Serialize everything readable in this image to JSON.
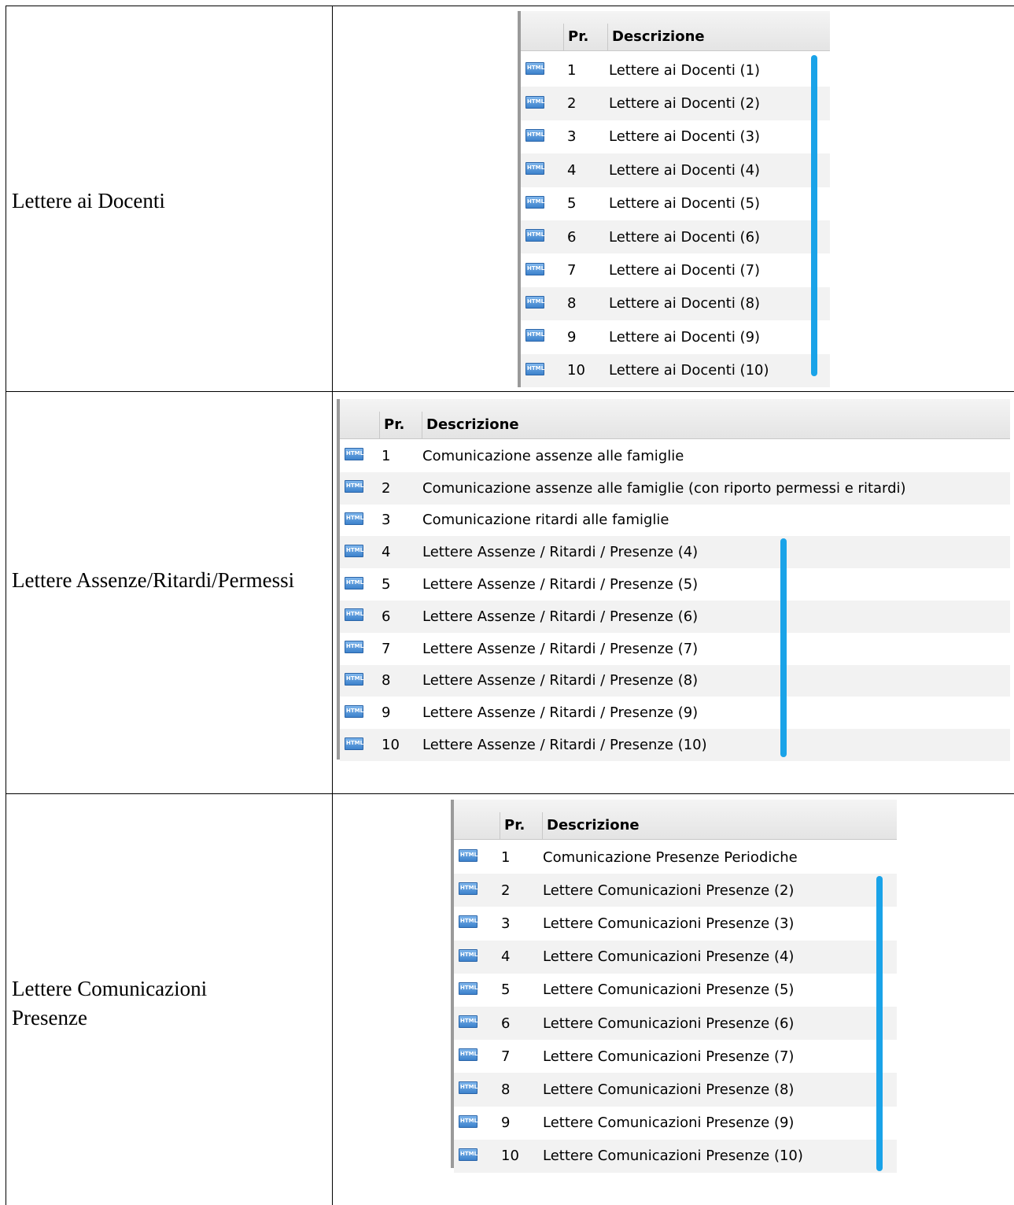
{
  "sections": [
    {
      "label": "Lettere ai Docenti",
      "grid": {
        "header": {
          "pr": "Pr.",
          "desc": "Descrizione"
        },
        "rows": [
          {
            "pr": "1",
            "desc": "Lettere ai Docenti (1)"
          },
          {
            "pr": "2",
            "desc": "Lettere ai Docenti (2)"
          },
          {
            "pr": "3",
            "desc": "Lettere ai Docenti (3)"
          },
          {
            "pr": "4",
            "desc": "Lettere ai Docenti (4)"
          },
          {
            "pr": "5",
            "desc": "Lettere ai Docenti (5)"
          },
          {
            "pr": "6",
            "desc": "Lettere ai Docenti (6)"
          },
          {
            "pr": "7",
            "desc": "Lettere ai Docenti (7)"
          },
          {
            "pr": "8",
            "desc": "Lettere ai Docenti (8)"
          },
          {
            "pr": "9",
            "desc": "Lettere ai Docenti (9)"
          },
          {
            "pr": "10",
            "desc": "Lettere ai Docenti (10)"
          }
        ]
      }
    },
    {
      "label": "Lettere Assenze/Ritardi/Permessi",
      "grid": {
        "header": {
          "pr": "Pr.",
          "desc": "Descrizione"
        },
        "rows": [
          {
            "pr": "1",
            "desc": "Comunicazione assenze alle famiglie"
          },
          {
            "pr": "2",
            "desc": "Comunicazione assenze alle famiglie (con riporto permessi e ritardi)"
          },
          {
            "pr": "3",
            "desc": "Comunicazione ritardi alle famiglie"
          },
          {
            "pr": "4",
            "desc": "Lettere Assenze / Ritardi / Presenze (4)"
          },
          {
            "pr": "5",
            "desc": "Lettere Assenze / Ritardi / Presenze (5)"
          },
          {
            "pr": "6",
            "desc": "Lettere Assenze / Ritardi / Presenze (6)"
          },
          {
            "pr": "7",
            "desc": "Lettere Assenze / Ritardi / Presenze (7)"
          },
          {
            "pr": "8",
            "desc": "Lettere Assenze / Ritardi / Presenze (8)"
          },
          {
            "pr": "9",
            "desc": "Lettere Assenze / Ritardi / Presenze (9)"
          },
          {
            "pr": "10",
            "desc": "Lettere Assenze / Ritardi / Presenze (10)"
          }
        ]
      }
    },
    {
      "label": "Lettere Comunicazioni Presenze",
      "grid": {
        "header": {
          "pr": "Pr.",
          "desc": "Descrizione"
        },
        "rows": [
          {
            "pr": "1",
            "desc": "Comunicazione Presenze Periodiche"
          },
          {
            "pr": "2",
            "desc": "Lettere Comunicazioni Presenze (2)"
          },
          {
            "pr": "3",
            "desc": "Lettere Comunicazioni Presenze (3)"
          },
          {
            "pr": "4",
            "desc": "Lettere Comunicazioni Presenze (4)"
          },
          {
            "pr": "5",
            "desc": "Lettere Comunicazioni Presenze (5)"
          },
          {
            "pr": "6",
            "desc": "Lettere Comunicazioni Presenze (6)"
          },
          {
            "pr": "7",
            "desc": "Lettere Comunicazioni Presenze (7)"
          },
          {
            "pr": "8",
            "desc": "Lettere Comunicazioni Presenze (8)"
          },
          {
            "pr": "9",
            "desc": "Lettere Comunicazioni Presenze (9)"
          },
          {
            "pr": "10",
            "desc": "Lettere Comunicazioni Presenze (10)"
          }
        ]
      }
    }
  ],
  "colors": {
    "highlight_bar": "#1aa3e8",
    "alt_row": "#f2f2f2",
    "icon": "#3d82cc"
  },
  "icon_name": "html-file-icon"
}
